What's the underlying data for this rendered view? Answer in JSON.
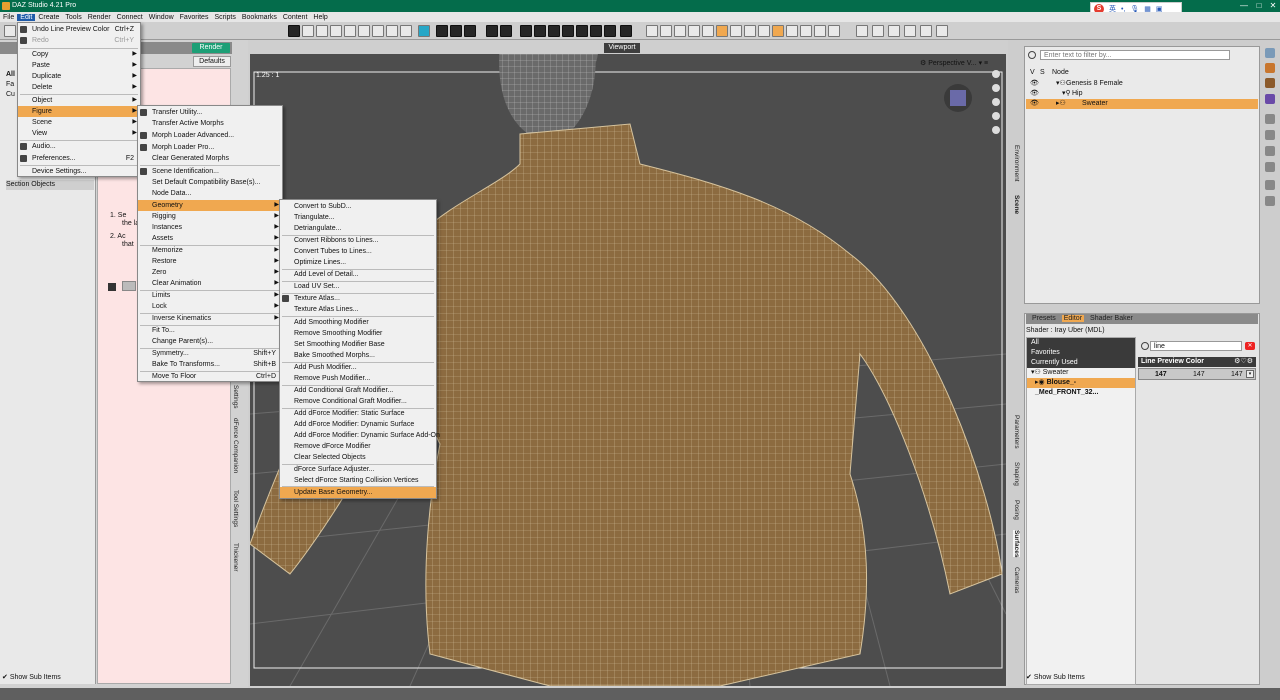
{
  "window": {
    "title": "DAZ Studio 4.21 Pro"
  },
  "ime": {
    "label": "英"
  },
  "menubar": [
    "File",
    "Edit",
    "Create",
    "Tools",
    "Render",
    "Connect",
    "Window",
    "Favorites",
    "Scripts",
    "Bookmarks",
    "Content",
    "Help"
  ],
  "left_panel": {
    "render_label": "Render",
    "defaults_label": "Defaults",
    "list_items": [
      "All",
      "Fa",
      "Cu",
      "Section Objects"
    ],
    "content_steps": [
      "1. Se",
      "the la",
      "2. Ac",
      "that"
    ],
    "show_sub_items": "Show Sub Items",
    "vertical_tabs": [
      "Settings",
      "dForce Companion",
      "Tool Settings",
      "Thickener"
    ]
  },
  "edit_menu": {
    "items": [
      {
        "label": "Undo Line Preview Color",
        "shortcut": "Ctrl+Z"
      },
      {
        "label": "Redo",
        "shortcut": "Ctrl+Y"
      },
      {
        "label": "Copy"
      },
      {
        "label": "Paste"
      },
      {
        "label": "Duplicate"
      },
      {
        "label": "Delete"
      },
      {
        "label": "Object"
      },
      {
        "label": "Figure"
      },
      {
        "label": "Scene"
      },
      {
        "label": "View"
      },
      {
        "label": "Audio..."
      },
      {
        "label": "Preferences...",
        "shortcut": "F2"
      },
      {
        "label": "Device Settings..."
      }
    ]
  },
  "figure_menu": {
    "items": [
      {
        "label": "Transfer Utility..."
      },
      {
        "label": "Transfer Active Morphs"
      },
      {
        "label": "Morph Loader Advanced..."
      },
      {
        "label": "Morph Loader Pro..."
      },
      {
        "label": "Clear Generated Morphs"
      },
      {
        "label": "Scene Identification..."
      },
      {
        "label": "Set Default Compatibility Base(s)..."
      },
      {
        "label": "Node Data..."
      },
      {
        "label": "Geometry"
      },
      {
        "label": "Rigging"
      },
      {
        "label": "Instances"
      },
      {
        "label": "Assets"
      },
      {
        "label": "Memorize"
      },
      {
        "label": "Restore"
      },
      {
        "label": "Zero"
      },
      {
        "label": "Clear Animation"
      },
      {
        "label": "Limits"
      },
      {
        "label": "Lock"
      },
      {
        "label": "Inverse Kinematics"
      },
      {
        "label": "Fit To..."
      },
      {
        "label": "Change Parent(s)..."
      },
      {
        "label": "Symmetry...",
        "shortcut": "Shift+Y"
      },
      {
        "label": "Bake To Transforms...",
        "shortcut": "Shift+B"
      },
      {
        "label": "Move To Floor",
        "shortcut": "Ctrl+D"
      }
    ]
  },
  "geometry_menu": {
    "items": [
      {
        "label": "Convert to SubD..."
      },
      {
        "label": "Triangulate..."
      },
      {
        "label": "Detriangulate..."
      },
      {
        "label": "Convert Ribbons to Lines..."
      },
      {
        "label": "Convert Tubes to Lines..."
      },
      {
        "label": "Optimize Lines..."
      },
      {
        "label": "Add Level of Detail..."
      },
      {
        "label": "Load UV Set..."
      },
      {
        "label": "Texture Atlas..."
      },
      {
        "label": "Texture Atlas Lines..."
      },
      {
        "label": "Add Smoothing Modifier"
      },
      {
        "label": "Remove Smoothing Modifier"
      },
      {
        "label": "Set Smoothing Modifier Base"
      },
      {
        "label": "Bake Smoothed Morphs..."
      },
      {
        "label": "Add Push Modifier..."
      },
      {
        "label": "Remove Push Modifier..."
      },
      {
        "label": "Add Conditional Graft Modifier..."
      },
      {
        "label": "Remove Conditional Graft Modifier..."
      },
      {
        "label": "Add dForce Modifier: Static Surface"
      },
      {
        "label": "Add dForce Modifier: Dynamic Surface"
      },
      {
        "label": "Add dForce Modifier: Dynamic Surface Add-On"
      },
      {
        "label": "Remove dForce Modifier"
      },
      {
        "label": "Clear Selected Objects"
      },
      {
        "label": "dForce Surface Adjuster..."
      },
      {
        "label": "Select dForce Starting Collision Vertices"
      },
      {
        "label": "Update Base Geometry..."
      }
    ]
  },
  "viewport": {
    "label": "Viewport",
    "camera": "Perspective V...",
    "ratio": "1.25 : 1"
  },
  "scene_panel": {
    "search_placeholder": "Enter text to filter by...",
    "header": {
      "v": "V",
      "s": "S",
      "node": "Node"
    },
    "nodes": [
      "Genesis 8 Female",
      "Hip",
      "Sweater"
    ],
    "tabs": [
      "Environment",
      "Scene"
    ]
  },
  "surfaces_panel": {
    "tabs": [
      "Presets",
      "Editor",
      "Shader Baker"
    ],
    "shader": "Shader : Iray Uber (MDL)",
    "tree": [
      "All",
      "Favorites",
      "Currently Used",
      "Sweater",
      "Blouse_-_Med_FRONT_32..."
    ],
    "search_value": "line",
    "property_name": "Line Preview Color",
    "property_values": [
      "147",
      "147",
      "147"
    ],
    "show_sub_items": "Show Sub Items",
    "vertical_tabs": [
      "Parameters",
      "Shaping",
      "Posing",
      "Surfaces",
      "Cameras"
    ]
  },
  "colors": {
    "title_bar": "#046c4b",
    "highlight": "#f0a850",
    "render_button": "#1d9f76",
    "menu_active": "#1e5aa8"
  }
}
